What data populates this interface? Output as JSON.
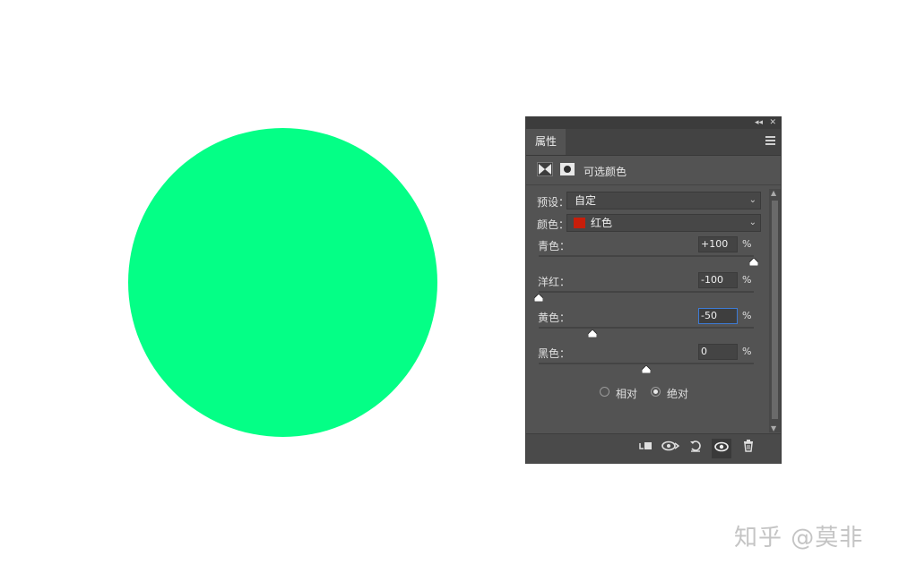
{
  "canvas": {
    "circle_color": "#04ff86",
    "background": "#ffffff"
  },
  "panel": {
    "collapse_icon": "double-chevron-left-icon",
    "close_icon": "close-icon",
    "tab_label": "属性",
    "menu_icon": "panel-menu-icon",
    "adjustment_title": "可选颜色",
    "preset": {
      "label": "预设：",
      "value": "自定"
    },
    "colors": {
      "label": "颜色：",
      "value": "红色",
      "swatch": "#c81e0a"
    },
    "sliders": [
      {
        "label": "青色：",
        "value": "+100",
        "unit": "%",
        "level": 100
      },
      {
        "label": "洋红：",
        "value": "-100",
        "unit": "%",
        "level": -100
      },
      {
        "label": "黄色：",
        "value": "-50",
        "unit": "%",
        "level": -50
      },
      {
        "label": "黑色：",
        "value": "0",
        "unit": "%",
        "level": 0
      }
    ],
    "method": {
      "relative": "相对",
      "absolute": "绝对",
      "selected": "absolute"
    },
    "footer_icons": [
      "clip-to-layer-icon",
      "view-previous-state-icon",
      "reset-icon",
      "visibility-eye-icon",
      "trash-icon"
    ]
  },
  "watermark": "知乎 @莫非"
}
